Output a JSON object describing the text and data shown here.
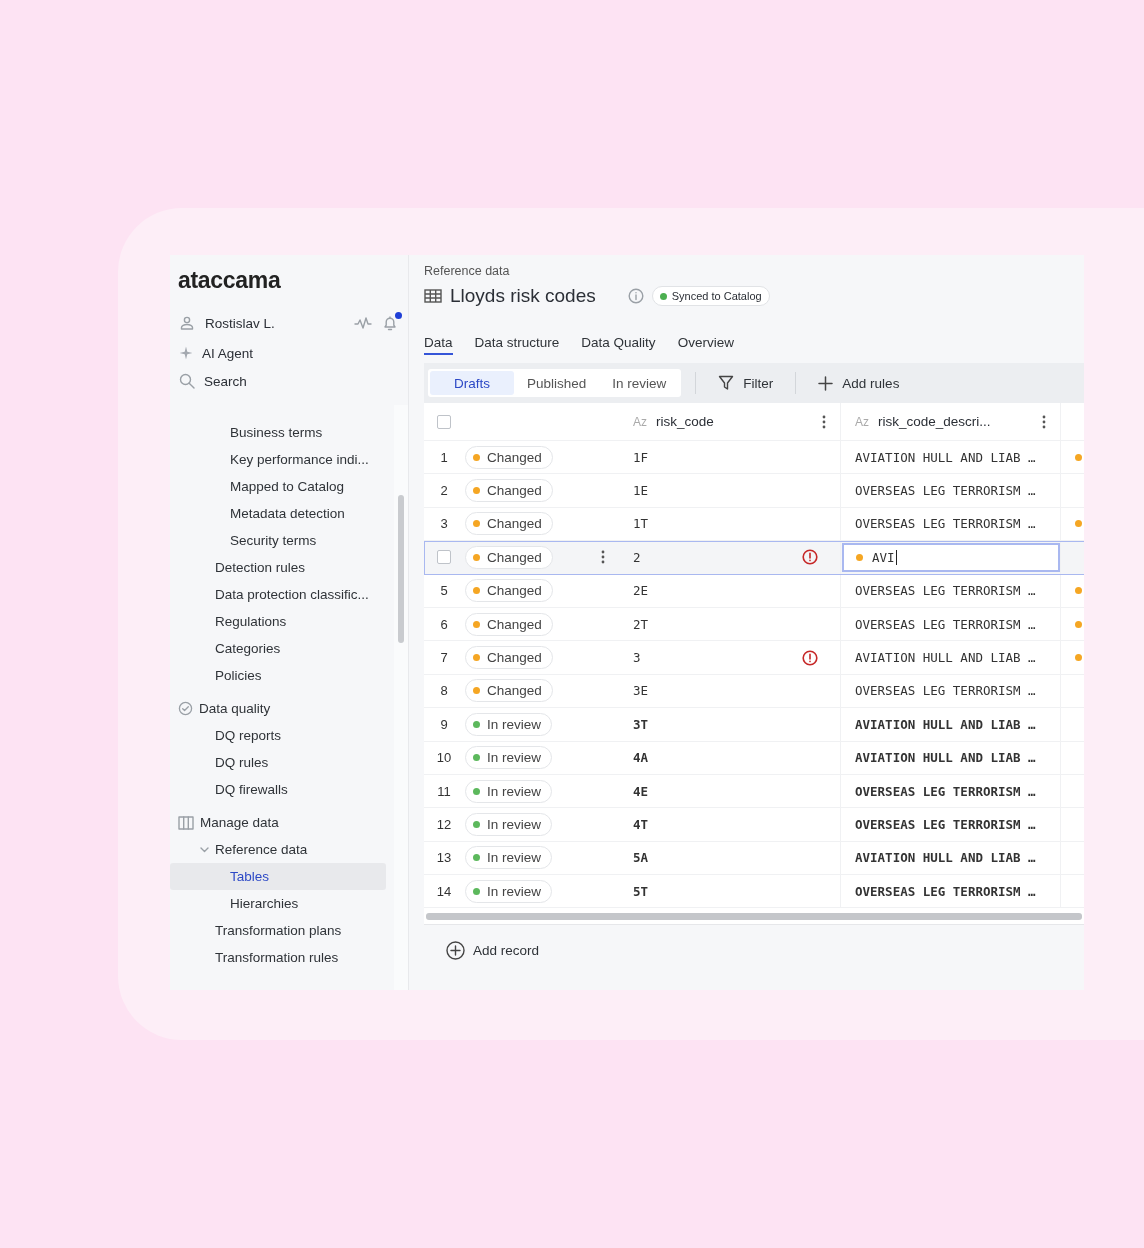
{
  "brand": {
    "logo": "ataccama"
  },
  "user": {
    "name": "Rostislav L.",
    "notifications": true
  },
  "nav_top": [
    {
      "kind": "agent",
      "label": "AI Agent"
    },
    {
      "kind": "search",
      "label": "Search"
    }
  ],
  "sidebar": {
    "items": [
      {
        "children": [
          {
            "children": [
              {
                "label": "Business terms",
                "selected": false
              },
              {
                "label": "Key performance indi...",
                "selected": false
              },
              {
                "label": "Mapped to Catalog",
                "selected": false
              },
              {
                "label": "Metadata detection",
                "selected": false
              },
              {
                "label": "Security terms",
                "selected": false
              }
            ]
          },
          {
            "label": "Detection rules",
            "selected": false
          },
          {
            "label": "Data protection classific...",
            "selected": false
          },
          {
            "label": "Regulations",
            "selected": false
          },
          {
            "label": "Categories",
            "selected": false
          },
          {
            "label": "Policies",
            "selected": false
          }
        ]
      },
      {
        "label": "Data quality",
        "kind": "quality",
        "selected": false,
        "children": [
          {
            "label": "DQ reports",
            "selected": false
          },
          {
            "label": "DQ rules",
            "selected": false
          },
          {
            "label": "DQ firewalls",
            "selected": false
          }
        ]
      },
      {
        "label": "Manage data",
        "kind": "columns",
        "selected": false,
        "children": [
          {
            "label": "Reference data",
            "expanded": true,
            "selected": false,
            "children": [
              {
                "label": "Tables",
                "selected": true
              },
              {
                "label": "Hierarchies",
                "selected": false
              }
            ]
          },
          {
            "label": "Transformation plans",
            "selected": false
          },
          {
            "label": "Transformation rules",
            "selected": false
          }
        ]
      }
    ]
  },
  "header": {
    "breadcrumb": "Reference data",
    "title": "Lloyds risk codes",
    "badge": {
      "label": "Synced to Catalog",
      "color": "#4caf50"
    }
  },
  "tabs": [
    {
      "label": "Data",
      "selected": true
    },
    {
      "label": "Data structure",
      "selected": false
    },
    {
      "label": "Data Quality",
      "selected": false
    },
    {
      "label": "Overview",
      "selected": false
    }
  ],
  "toolbar": {
    "segments": [
      {
        "label": "Drafts",
        "selected": true
      },
      {
        "label": "Published",
        "selected": false
      },
      {
        "label": "In review",
        "selected": false
      }
    ],
    "filter": "Filter",
    "add_rules": "Add rules"
  },
  "table": {
    "select_all": {
      "checked": false
    },
    "columns": [
      {
        "type": "Az",
        "label": "risk_code"
      },
      {
        "type": "Az",
        "label": "risk_code_descri..."
      }
    ],
    "rows": [
      {
        "number": "1",
        "selected": false,
        "status": {
          "kind": "changed",
          "label": "Changed",
          "color": "#f5a623"
        },
        "risk_code": "1F",
        "error": false,
        "description": "AVIATION HULL AND LIAB …",
        "editing": false,
        "column_3_dot": true
      },
      {
        "number": "2",
        "selected": false,
        "status": {
          "kind": "changed",
          "label": "Changed",
          "color": "#f5a623"
        },
        "risk_code": "1E",
        "error": false,
        "description": "OVERSEAS LEG TERRORISM …",
        "editing": false,
        "column_3_dot": false
      },
      {
        "number": "3",
        "selected": false,
        "status": {
          "kind": "changed",
          "label": "Changed",
          "color": "#f5a623"
        },
        "risk_code": "1T",
        "error": false,
        "description": "OVERSEAS LEG TERRORISM …",
        "editing": false,
        "column_3_dot": true
      },
      {
        "selected": true,
        "checked": false,
        "status": {
          "kind": "changed",
          "label": "Changed",
          "color": "#f5a623"
        },
        "risk_code": "2",
        "error": true,
        "description": "AVI",
        "editing": true,
        "column_3_dot": false
      },
      {
        "number": "5",
        "selected": false,
        "status": {
          "kind": "changed",
          "label": "Changed",
          "color": "#f5a623"
        },
        "risk_code": "2E",
        "error": false,
        "description": "OVERSEAS LEG TERRORISM …",
        "editing": false,
        "column_3_dot": true
      },
      {
        "number": "6",
        "selected": false,
        "status": {
          "kind": "changed",
          "label": "Changed",
          "color": "#f5a623"
        },
        "risk_code": "2T",
        "error": false,
        "description": "OVERSEAS LEG TERRORISM …",
        "editing": false,
        "column_3_dot": true
      },
      {
        "number": "7",
        "selected": false,
        "status": {
          "kind": "changed",
          "label": "Changed",
          "color": "#f5a623"
        },
        "risk_code": "3",
        "error": true,
        "description": "AVIATION HULL AND LIAB …",
        "editing": false,
        "column_3_dot": true
      },
      {
        "number": "8",
        "selected": false,
        "status": {
          "kind": "changed",
          "label": "Changed",
          "color": "#f5a623"
        },
        "risk_code": "3E",
        "error": false,
        "description": "OVERSEAS LEG TERRORISM …",
        "editing": false,
        "column_3_dot": false
      },
      {
        "number": "9",
        "selected": false,
        "status": {
          "kind": "review",
          "label": "In review",
          "color": "#5cb85c"
        },
        "risk_code": "3T",
        "error": false,
        "description": "AVIATION HULL AND LIAB …",
        "editing": false,
        "column_3_dot": false
      },
      {
        "number": "10",
        "selected": false,
        "status": {
          "kind": "review",
          "label": "In review",
          "color": "#5cb85c"
        },
        "risk_code": "4A",
        "error": false,
        "description": "AVIATION HULL AND LIAB …",
        "editing": false,
        "column_3_dot": false
      },
      {
        "number": "11",
        "selected": false,
        "status": {
          "kind": "review",
          "label": "In review",
          "color": "#5cb85c"
        },
        "risk_code": "4E",
        "error": false,
        "description": "OVERSEAS LEG TERRORISM …",
        "editing": false,
        "column_3_dot": false
      },
      {
        "number": "12",
        "selected": false,
        "status": {
          "kind": "review",
          "label": "In review",
          "color": "#5cb85c"
        },
        "risk_code": "4T",
        "error": false,
        "description": "OVERSEAS LEG TERRORISM …",
        "editing": false,
        "column_3_dot": false
      },
      {
        "number": "13",
        "selected": false,
        "status": {
          "kind": "review",
          "label": "In review",
          "color": "#5cb85c"
        },
        "risk_code": "5A",
        "error": false,
        "description": "AVIATION HULL AND LIAB …",
        "editing": false,
        "column_3_dot": false
      },
      {
        "number": "14",
        "selected": false,
        "status": {
          "kind": "review",
          "label": "In review",
          "color": "#5cb85c"
        },
        "risk_code": "5T",
        "error": false,
        "description": "OVERSEAS LEG TERRORISM …",
        "editing": false,
        "column_3_dot": false
      }
    ]
  },
  "add_record": "Add record"
}
